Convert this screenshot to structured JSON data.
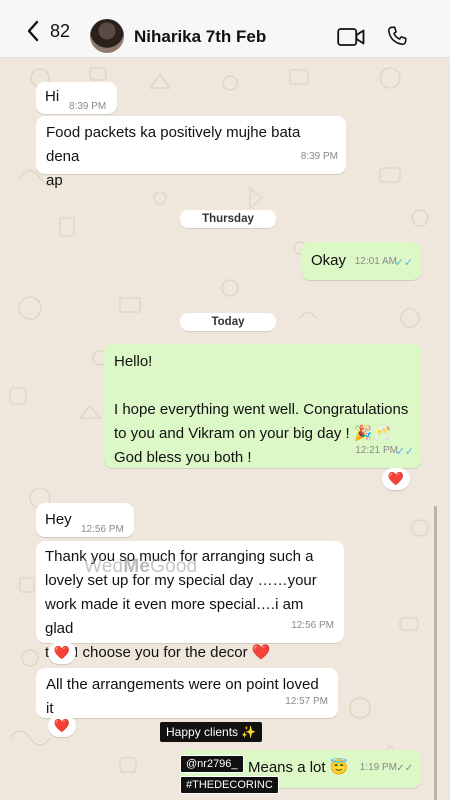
{
  "header": {
    "back_count": "82",
    "contact_name": "Niharika 7th Feb"
  },
  "messages": [
    {
      "text": "Hi",
      "time": "8:39 PM"
    },
    {
      "text_lines": [
        "Food packets ka positively mujhe bata dena",
        "ap"
      ],
      "time": "8:39 PM"
    },
    {
      "text": "Okay",
      "time": "12:01 AM"
    },
    {
      "text_lines": [
        "Hello!",
        "I hope everything went well. Congratulations",
        "to you and Vikram on your big day ! 🎉🥂",
        "God bless you both !"
      ],
      "time": "12:21 PM"
    },
    {
      "text": "Hey",
      "time": "12:56 PM"
    },
    {
      "text_lines": [
        "Thank you so much for arranging such a",
        "lovely set up for my special day ……your",
        "work made it even more special….i am glad",
        "that I choose you for the decor ❤️"
      ],
      "time": "12:56 PM"
    },
    {
      "text": "All the arrangements were on point loved it",
      "time": "12:57 PM"
    },
    {
      "text": "Means a lot 😇",
      "time": "1:19 PM"
    }
  ],
  "day_labels": {
    "thursday": "Thursday",
    "today": "Today"
  },
  "reaction_heart": "❤️",
  "overlay_tags": {
    "happy": "Happy clients ✨",
    "handle": "@nr2796_",
    "hashtag": "#THEDECORINC"
  },
  "watermark": {
    "part1": "Wed",
    "part2": "Me",
    "part3": "Good"
  },
  "ticks": "✓✓",
  "colors": {
    "incoming": "#ffffff",
    "outgoing": "#dcf8c6",
    "chat_bg": "#efe7dc",
    "read_ticks": "#4fb6ec"
  }
}
